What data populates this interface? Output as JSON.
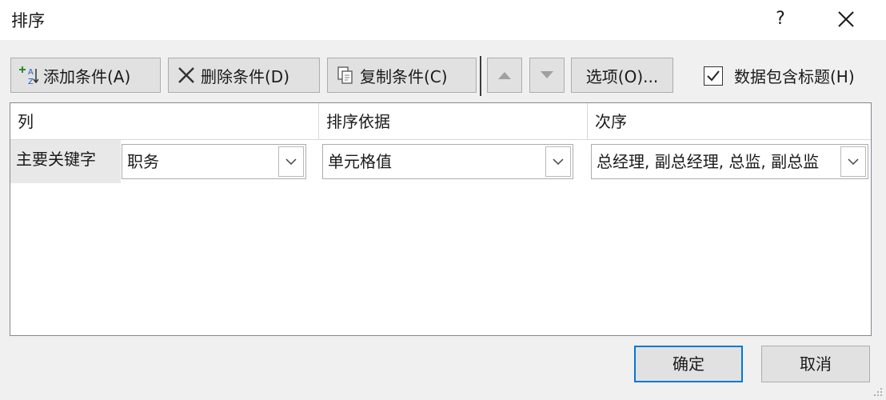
{
  "window": {
    "title": "排序",
    "help_label": "?",
    "close_icon": "close-icon"
  },
  "toolbar": {
    "add_label": "添加条件(A)",
    "add_icon": "add-sort-level-icon",
    "delete_label": "删除条件(D)",
    "delete_icon": "delete-x-icon",
    "copy_label": "复制条件(C)",
    "copy_icon": "copy-icon",
    "move_up_icon": "arrow-up-icon",
    "move_down_icon": "arrow-down-icon",
    "options_label": "选项(O)...",
    "header_checkbox_checked": true,
    "header_checkbox_label": "数据包含标题(H)"
  },
  "grid": {
    "columns": [
      "列",
      "排序依据",
      "次序"
    ],
    "rows": [
      {
        "label": "主要关键字",
        "column_value": "职务",
        "sort_on_value": "单元格值",
        "order_value": "总经理, 副总经理, 总监, 副总监"
      }
    ]
  },
  "footer": {
    "ok_label": "确定",
    "cancel_label": "取消"
  },
  "colors": {
    "dialog_bg": "#f0f0f0",
    "button_bg": "#e1e1e1",
    "default_button_border": "#0078d7"
  }
}
